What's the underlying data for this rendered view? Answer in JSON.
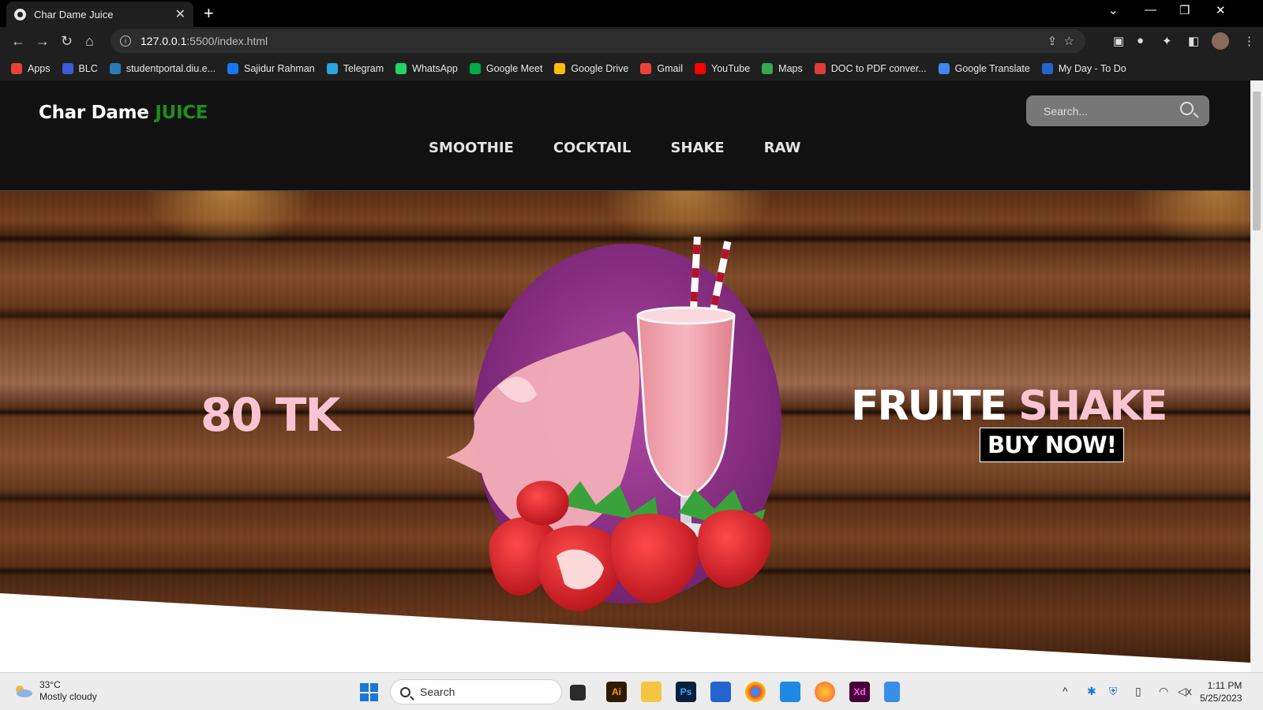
{
  "browser": {
    "tab_title": "Char Dame Juice",
    "tab_close": "✕",
    "new_tab": "+",
    "url_host": "127.0.0.1",
    "url_rest": ":5500/index.html",
    "bookmarks": [
      {
        "label": "Apps",
        "color": "#e94235"
      },
      {
        "label": "BLC",
        "color": "#3b5bdb"
      },
      {
        "label": "studentportal.diu.e...",
        "color": "#2b7bb9"
      },
      {
        "label": "Sajidur Rahman",
        "color": "#1877f2"
      },
      {
        "label": "Telegram",
        "color": "#2aa3df"
      },
      {
        "label": "WhatsApp",
        "color": "#25d366"
      },
      {
        "label": "Google Meet",
        "color": "#00ac47"
      },
      {
        "label": "Google Drive",
        "color": "#fbbc04"
      },
      {
        "label": "Gmail",
        "color": "#ea4335"
      },
      {
        "label": "YouTube",
        "color": "#ff0000"
      },
      {
        "label": "Maps",
        "color": "#34a853"
      },
      {
        "label": "DOC to PDF conver...",
        "color": "#e03b3b"
      },
      {
        "label": "Google Translate",
        "color": "#4285f4"
      },
      {
        "label": "My Day - To Do",
        "color": "#2564cf"
      }
    ]
  },
  "site": {
    "logo_main": "Char Dame ",
    "logo_accent": "JUICE",
    "search_placeholder": "Search...",
    "menu": [
      "SMOOTHIE",
      "COCKTAIL",
      "SHAKE",
      "RAW"
    ],
    "price": "80 TK",
    "headline_white": "FRUITE ",
    "headline_pink": "SHAKE",
    "buy_label": "BUY NOW!"
  },
  "taskbar": {
    "temp": "33°C",
    "weather": "Mostly cloudy",
    "search_label": "Search",
    "time": "1:11 PM",
    "date": "5/25/2023"
  },
  "colors": {
    "accent_green": "#1c8f1c",
    "accent_pink": "#f9c4d2",
    "header_bg": "#111111"
  }
}
